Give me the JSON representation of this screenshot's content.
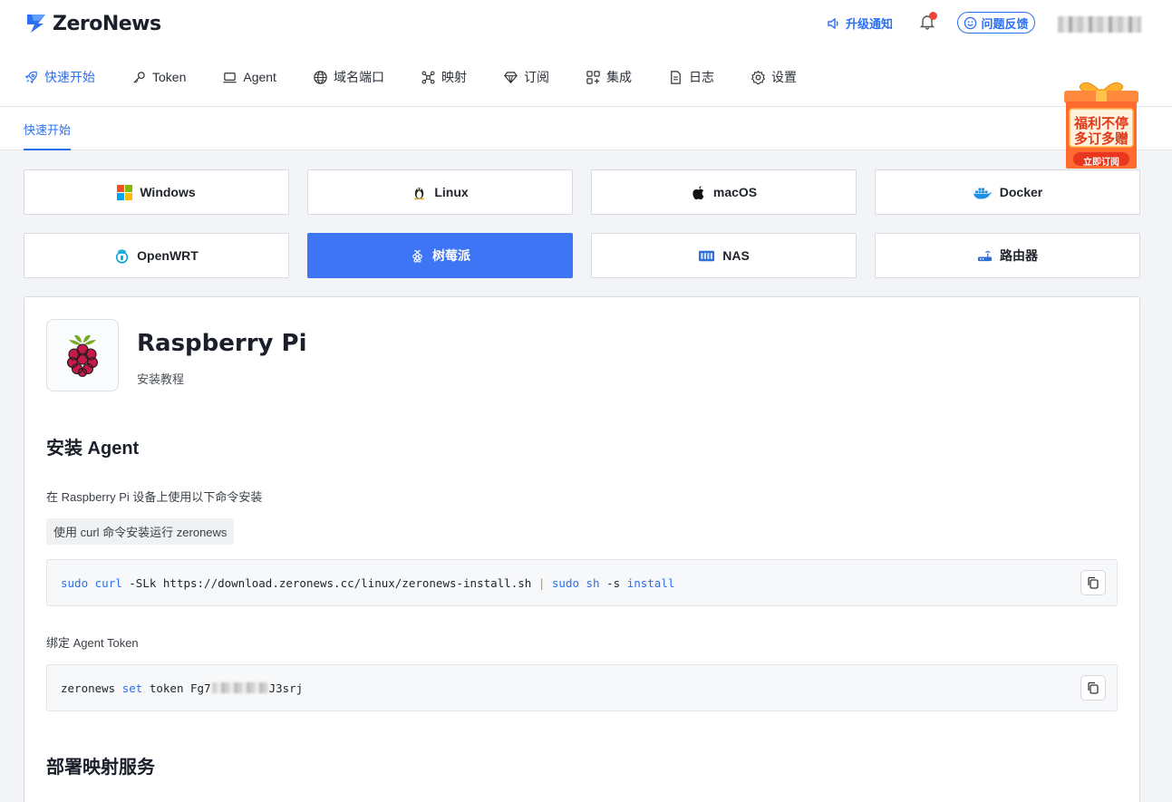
{
  "app": {
    "name": "ZeroNews"
  },
  "header": {
    "upgrade_label": "升级通知",
    "feedback_label": "问题反馈",
    "user_name": "████████"
  },
  "nav": {
    "items": [
      {
        "label": "快速开始",
        "icon": "rocket-icon",
        "active": true
      },
      {
        "label": "Token",
        "icon": "key-icon"
      },
      {
        "label": "Agent",
        "icon": "laptop-icon"
      },
      {
        "label": "域名端口",
        "icon": "globe-icon"
      },
      {
        "label": "映射",
        "icon": "network-icon"
      },
      {
        "label": "订阅",
        "icon": "diamond-icon"
      },
      {
        "label": "集成",
        "icon": "apps-icon"
      },
      {
        "label": "日志",
        "icon": "document-icon"
      },
      {
        "label": "设置",
        "icon": "gear-icon"
      }
    ]
  },
  "subnav": {
    "active_tab": "快速开始"
  },
  "promo": {
    "line1": "福利不停",
    "line2": "多订多赠",
    "cta": "立即订阅"
  },
  "platforms": [
    {
      "label": "Windows",
      "icon": "windows-icon"
    },
    {
      "label": "Linux",
      "icon": "tux-icon"
    },
    {
      "label": "macOS",
      "icon": "apple-icon"
    },
    {
      "label": "Docker",
      "icon": "docker-icon"
    },
    {
      "label": "OpenWRT",
      "icon": "openwrt-icon"
    },
    {
      "label": "树莓派",
      "icon": "raspberry-icon",
      "active": true
    },
    {
      "label": "NAS",
      "icon": "nas-icon"
    },
    {
      "label": "路由器",
      "icon": "router-icon"
    }
  ],
  "content": {
    "title": "Raspberry Pi",
    "subtitle": "安装教程",
    "section1_title": "安装 Agent",
    "section1_desc": "在 Raspberry Pi 设备上使用以下命令安装",
    "method_tag": "使用 curl 命令安装运行 zeronews",
    "install_cmd": {
      "sudo1": "sudo",
      "curl": "curl",
      "args": " -SLk https://download.zeronews.cc/linux/zeronews-install.sh ",
      "pipe": "|",
      "sudo2": "sudo",
      "sh": "sh",
      "flag": " -s ",
      "install": "install"
    },
    "bind_label": "绑定 Agent Token",
    "token_cmd": {
      "prefix": "zeronews ",
      "set": "set",
      "mid": " token Fg7",
      "suffix": "J3srj"
    },
    "section2_title": "部署映射服务"
  },
  "colors": {
    "accent": "#2b6ff3",
    "active_platform": "#3d75f5",
    "notify_dot": "#f04438"
  }
}
